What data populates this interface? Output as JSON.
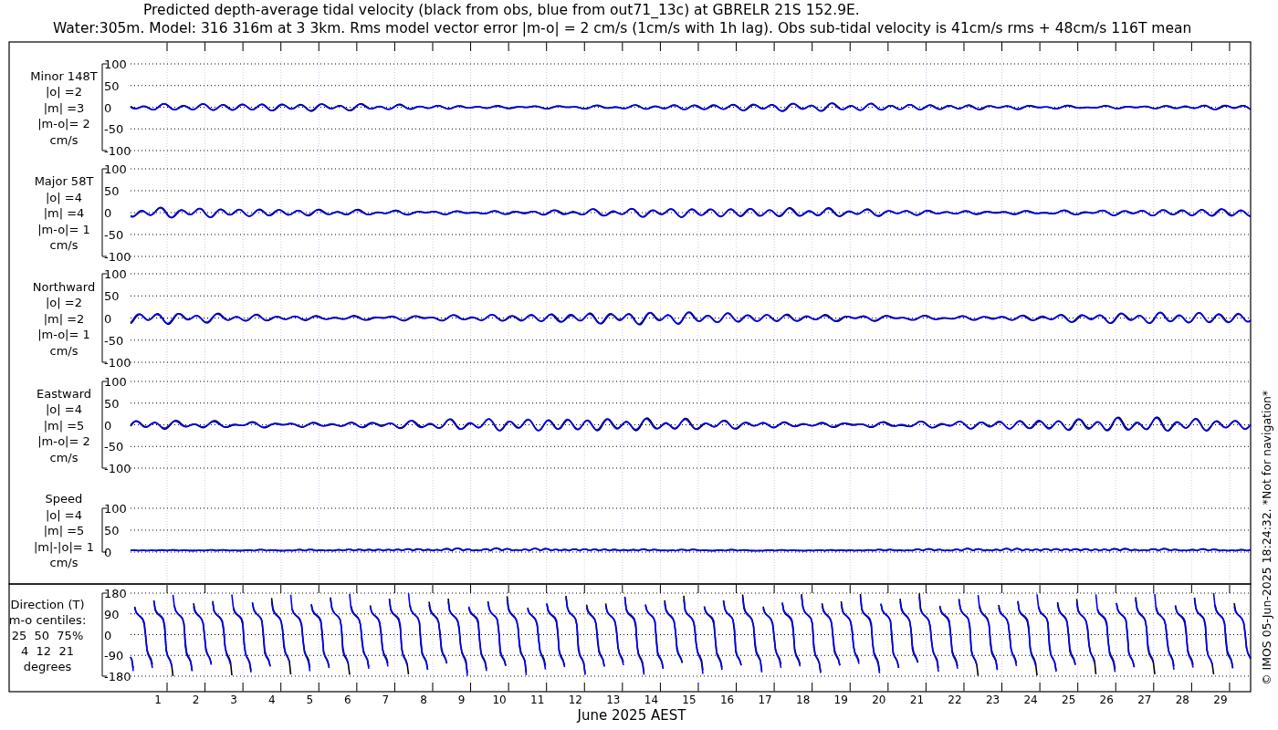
{
  "title_lines": [
    "Predicted depth-average tidal velocity (black from obs, blue from out71_13c) at GBRELR 21S 152.9E.",
    "Water:305m. Model: 316 316m at 3 3km. Rms model vector error |m-o| = 2 cm/s (1cm/s with 1h lag). Obs sub-tidal velocity is 41cm/s rms + 48cm/s 116T mean"
  ],
  "panels": [
    {
      "kind": "velocity",
      "label_lines": [
        "Minor 148T",
        "|o| =2",
        "|m| =3",
        "|m-o|= 2",
        "cm/s"
      ],
      "yticks": [
        "100",
        "50",
        "0",
        "-50",
        "-100"
      ]
    },
    {
      "kind": "velocity",
      "label_lines": [
        "Major 58T",
        "|o| =4",
        "|m| =4",
        "|m-o|= 1",
        "cm/s"
      ],
      "yticks": [
        "100",
        "50",
        "0",
        "-50",
        "-100"
      ]
    },
    {
      "kind": "velocity",
      "label_lines": [
        "Northward",
        "|o| =2",
        "|m| =2",
        "|m-o|= 1",
        "cm/s"
      ],
      "yticks": [
        "100",
        "50",
        "0",
        "-50",
        "-100"
      ]
    },
    {
      "kind": "velocity",
      "label_lines": [
        "Eastward",
        "|o| =4",
        "|m| =5",
        "|m-o|= 2",
        "cm/s"
      ],
      "yticks": [
        "100",
        "50",
        "0",
        "-50",
        "-100"
      ]
    },
    {
      "kind": "speed",
      "label_lines": [
        "Speed",
        "|o| =4",
        "|m| =5",
        "|m|-|o|= 1",
        "cm/s"
      ],
      "yticks": [
        "100",
        "50",
        "0"
      ]
    },
    {
      "kind": "direction",
      "label_lines": [
        "Direction (T)",
        "m-o centiles:",
        "25  50  75%",
        "4  12  21",
        "degrees"
      ],
      "yticks": [
        "180",
        "90",
        "0",
        "-90",
        "-180"
      ]
    }
  ],
  "day_labels": [
    "1",
    "2",
    "3",
    "4",
    "5",
    "6",
    "7",
    "8",
    "9",
    "10",
    "11",
    "12",
    "13",
    "14",
    "15",
    "16",
    "17",
    "18",
    "19",
    "20",
    "21",
    "22",
    "23",
    "24",
    "25",
    "26",
    "27",
    "28",
    "29"
  ],
  "xlabel": "June 2025 AEST",
  "credit": "© IMOS 05-Jun-2025 18:24:32. *Not for navigation*"
}
